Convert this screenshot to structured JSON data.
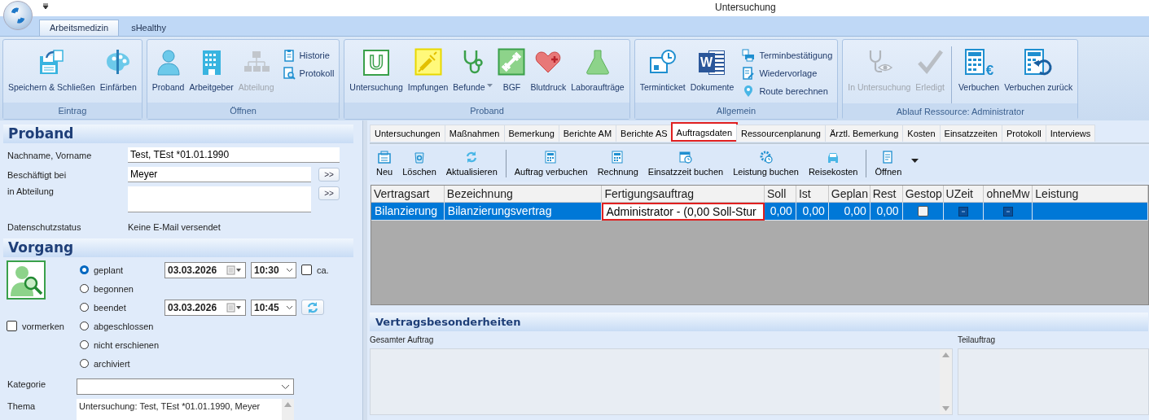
{
  "window": {
    "title": "Untersuchung"
  },
  "ribbon": {
    "tabs": [
      {
        "label": "Arbeitsmedizin",
        "selected": true
      },
      {
        "label": "sHealthy",
        "selected": false
      }
    ],
    "groups": [
      {
        "label": "Eintrag",
        "sections": [
          [
            {
              "label": "Speichern & Schließen",
              "kind": "large",
              "disabled": false,
              "dropdown": false
            },
            {
              "label": "Einfärben",
              "kind": "large",
              "disabled": false,
              "dropdown": false
            }
          ]
        ]
      },
      {
        "label": "Öffnen",
        "sections": [
          [
            {
              "label": "Proband",
              "kind": "large",
              "disabled": false,
              "dropdown": false
            },
            {
              "label": "Arbeitgeber",
              "kind": "large",
              "disabled": false,
              "dropdown": false
            },
            {
              "label": "Abteilung",
              "kind": "large",
              "disabled": true,
              "dropdown": false
            },
            {
              "label": "Historie",
              "kind": "small"
            },
            {
              "label": "Protokoll",
              "kind": "small"
            }
          ]
        ]
      },
      {
        "label": "Proband",
        "sections": [
          [
            {
              "label": "Untersuchung",
              "kind": "large",
              "disabled": false,
              "dropdown": false,
              "badge": "U"
            },
            {
              "label": "Impfungen",
              "kind": "large",
              "disabled": false,
              "dropdown": false
            },
            {
              "label": "Befunde",
              "kind": "large",
              "disabled": false,
              "dropdown": true
            },
            {
              "label": "BGF",
              "kind": "large",
              "disabled": false,
              "dropdown": false
            },
            {
              "label": "Blutdruck",
              "kind": "large",
              "disabled": false,
              "dropdown": false
            },
            {
              "label": "Laboraufträge",
              "kind": "large",
              "disabled": false,
              "dropdown": false
            }
          ]
        ]
      },
      {
        "label": "Allgemein",
        "sections": [
          [
            {
              "label": "Terminticket",
              "kind": "large",
              "disabled": false,
              "dropdown": false
            },
            {
              "label": "Dokumente",
              "kind": "large",
              "disabled": false,
              "dropdown": false,
              "badge": "W"
            },
            {
              "label": "Terminbestätigung",
              "kind": "small"
            },
            {
              "label": "Wiedervorlage",
              "kind": "small"
            },
            {
              "label": "Route berechnen",
              "kind": "small"
            }
          ]
        ]
      },
      {
        "label": "Ablauf Ressource: Administrator",
        "sections": [
          [
            {
              "label": "In Untersuchung",
              "kind": "large",
              "disabled": true,
              "dropdown": false
            },
            {
              "label": "Erledigt",
              "kind": "large",
              "disabled": true,
              "dropdown": false
            }
          ],
          [
            {
              "label": "Verbuchen",
              "kind": "large",
              "disabled": false,
              "dropdown": false,
              "badge": "€"
            },
            {
              "label": "Verbuchen zurück",
              "kind": "large",
              "disabled": false,
              "dropdown": false
            }
          ]
        ]
      }
    ]
  },
  "proband": {
    "title": "Proband",
    "name": {
      "label": "Nachname, Vorname",
      "value": "Test, TEst *01.01.1990"
    },
    "employer": {
      "label": "Beschäftigt bei",
      "value": "Meyer",
      "button": ">>"
    },
    "department": {
      "label": "in Abteilung",
      "button": ">>"
    },
    "privacy": {
      "label": "Datenschutzstatus",
      "value": "Keine E-Mail versendet"
    }
  },
  "vorgang": {
    "title": "Vorgang",
    "status": [
      {
        "label": "geplant",
        "selected": true
      },
      {
        "label": "begonnen",
        "selected": false
      },
      {
        "label": "beendet",
        "selected": false
      },
      {
        "label": "abgeschlossen",
        "selected": false
      },
      {
        "label": "nicht erschienen",
        "selected": false
      },
      {
        "label": "archiviert",
        "selected": false
      }
    ],
    "start": {
      "date": "03.03.2026",
      "time": "10:30"
    },
    "approx": {
      "label": "ca.",
      "checked": false
    },
    "end": {
      "date": "03.03.2026",
      "time": "10:45"
    },
    "reserve": {
      "label": "vormerken",
      "checked": false
    },
    "category": {
      "label": "Kategorie"
    },
    "topic": {
      "label": "Thema",
      "value": "Untersuchung: Test, TEst *01.01.1990, Meyer"
    }
  },
  "tabs": [
    {
      "label": "Untersuchungen",
      "selected": false,
      "highlighted": false
    },
    {
      "label": "Maßnahmen",
      "selected": false,
      "highlighted": false
    },
    {
      "label": "Bemerkung",
      "selected": false,
      "highlighted": false
    },
    {
      "label": "Berichte AM",
      "selected": false,
      "highlighted": false
    },
    {
      "label": "Berichte AS",
      "selected": false,
      "highlighted": false
    },
    {
      "label": "Auftragsdaten",
      "selected": true,
      "highlighted": true
    },
    {
      "label": "Ressourcenplanung",
      "selected": false,
      "highlighted": false
    },
    {
      "label": "Ärztl. Bemerkung",
      "selected": false,
      "highlighted": false
    },
    {
      "label": "Kosten",
      "selected": false,
      "highlighted": false
    },
    {
      "label": "Einsatzzeiten",
      "selected": false,
      "highlighted": false
    },
    {
      "label": "Protokoll",
      "selected": false,
      "highlighted": false
    },
    {
      "label": "Interviews",
      "selected": false,
      "highlighted": false
    }
  ],
  "toolbar": {
    "groups": [
      [
        {
          "label": "Neu"
        },
        {
          "label": "Löschen"
        },
        {
          "label": "Aktualisieren"
        }
      ],
      [
        {
          "label": "Auftrag verbuchen"
        },
        {
          "label": "Rechnung"
        },
        {
          "label": "Einsatzzeit buchen"
        },
        {
          "label": "Leistung buchen"
        },
        {
          "label": "Reisekosten"
        }
      ],
      [
        {
          "label": "Öffnen"
        }
      ]
    ]
  },
  "table": {
    "columns": [
      "Vertragsart",
      "Bezeichnung",
      "Fertigungsauftrag",
      "Soll",
      "Ist",
      "Geplan",
      "Rest",
      "Gestop",
      "UZeit",
      "ohneMw",
      "Leistung"
    ],
    "rows": [
      {
        "selected": true,
        "cells": [
          {
            "kind": "text",
            "text": "Bilanzierung",
            "highlighted": false
          },
          {
            "kind": "text",
            "text": "Bilanzierungsvertrag",
            "highlighted": false
          },
          {
            "kind": "text",
            "text": "Administrator  -  (0,00 Soll-Stur",
            "highlighted": true
          },
          {
            "kind": "number",
            "text": "0,00",
            "highlighted": false
          },
          {
            "kind": "number",
            "text": "0,00",
            "highlighted": false
          },
          {
            "kind": "number",
            "text": "0,00",
            "highlighted": false
          },
          {
            "kind": "number",
            "text": "0,00",
            "highlighted": false
          },
          {
            "kind": "checkbox",
            "checked": false,
            "highlighted": false
          },
          {
            "kind": "indeterminate",
            "highlighted": false
          },
          {
            "kind": "indeterminate",
            "highlighted": false
          },
          {
            "kind": "empty",
            "highlighted": false
          }
        ]
      }
    ]
  },
  "details": {
    "title": "Vertragsbesonderheiten",
    "fields": [
      {
        "label": "Gesamter Auftrag"
      },
      {
        "label": "Teilauftrag"
      }
    ]
  }
}
